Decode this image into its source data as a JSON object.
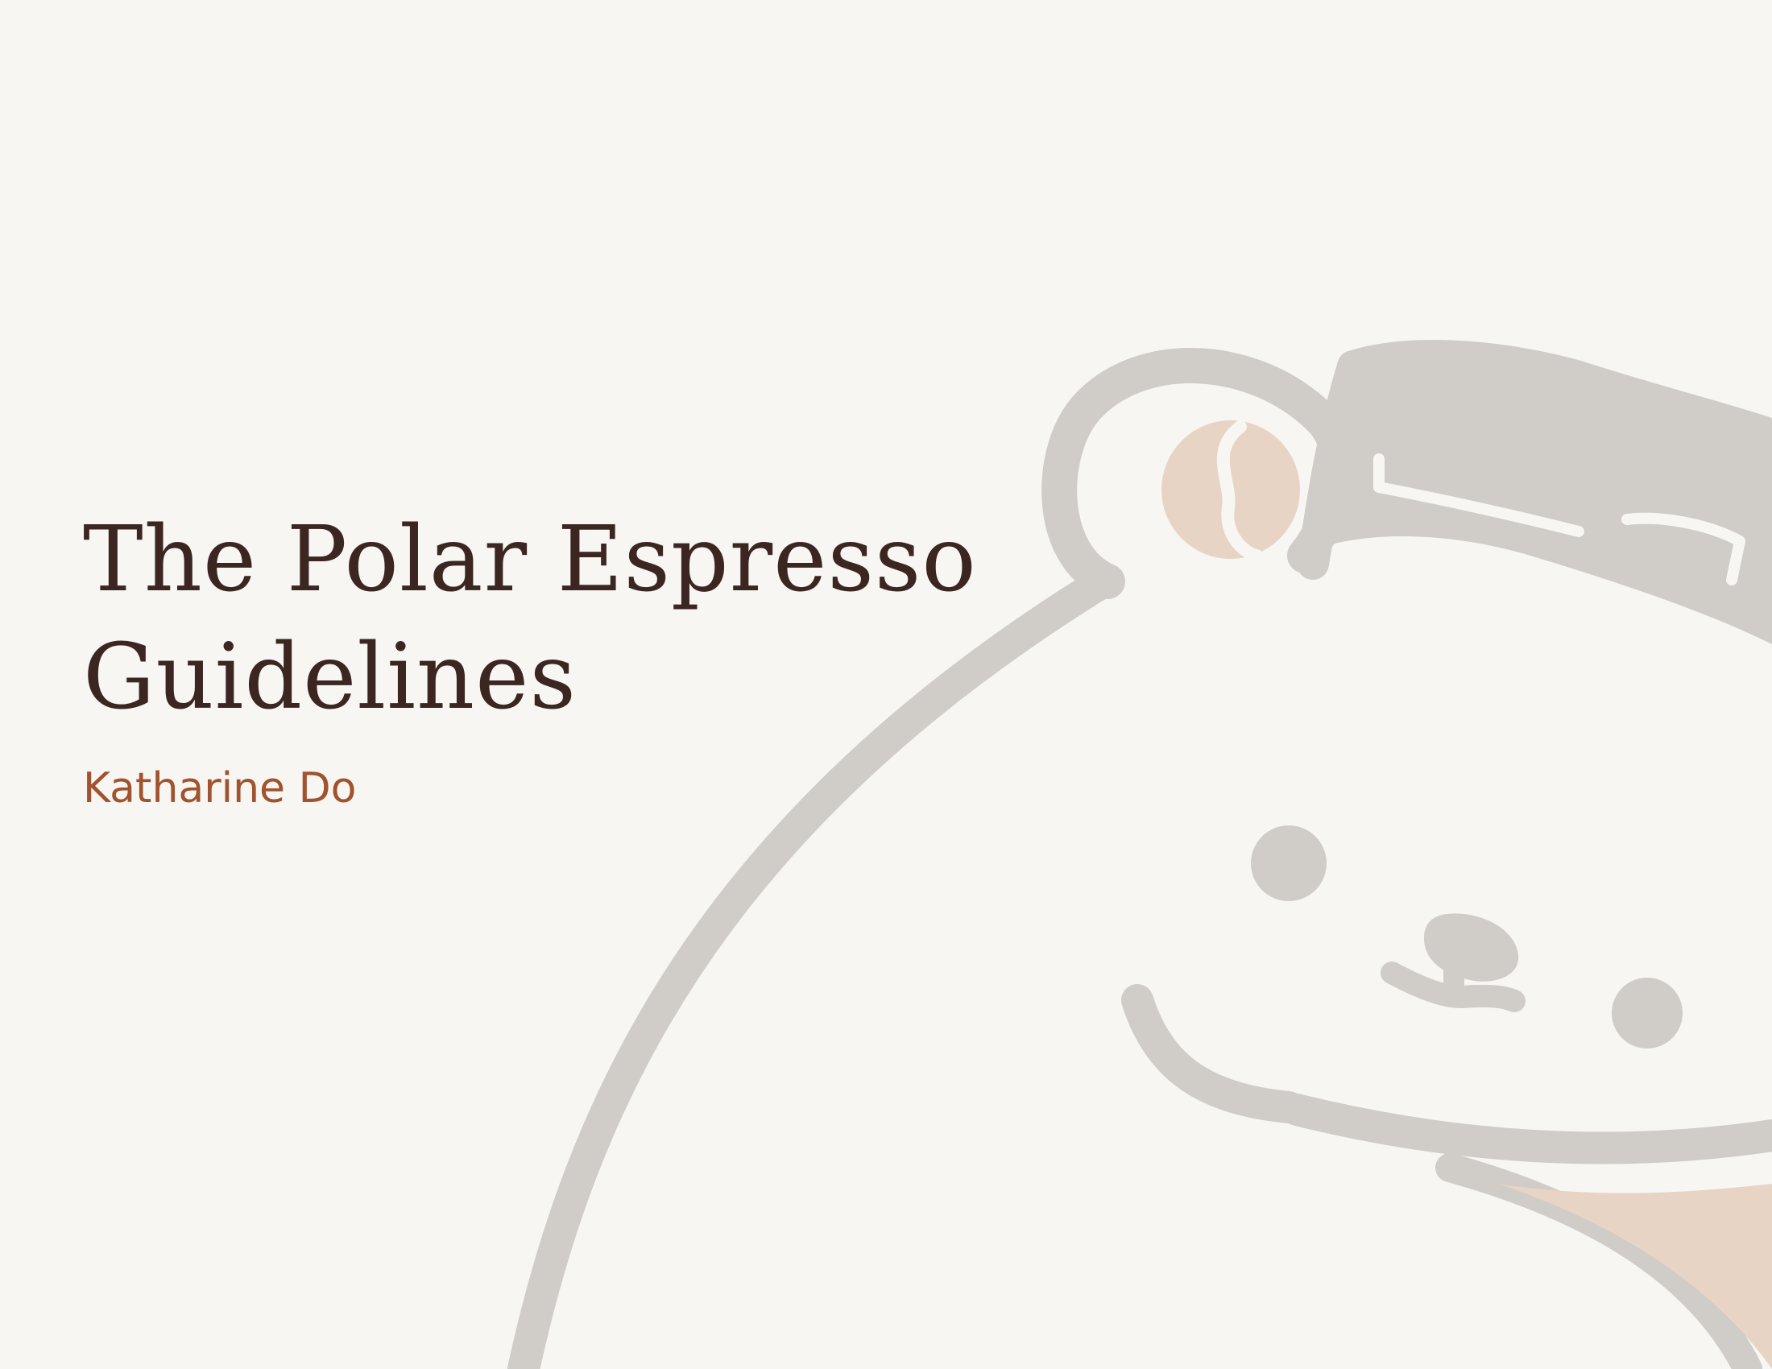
{
  "document": {
    "title_line_1": "The Polar Espresso",
    "title_line_2": "Guidelines",
    "author": "Katharine Do"
  },
  "colors": {
    "background": "#f7f6f2",
    "title": "#3b2622",
    "author": "#a0532e",
    "illustration_outline": "#d0ccc7",
    "illustration_accent": "#e8d4c4"
  },
  "illustration": {
    "icon": "polar-bear-barista-icon"
  }
}
